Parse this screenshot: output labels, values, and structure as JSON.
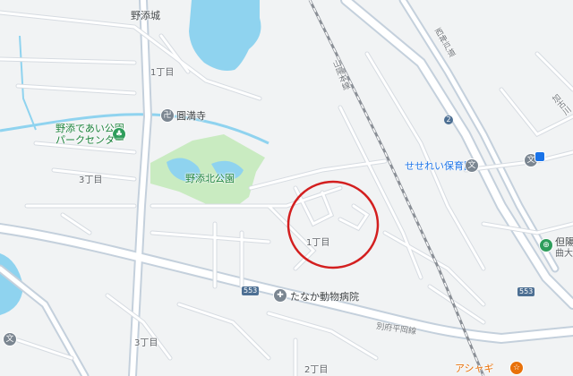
{
  "colors": {
    "background": "#f1f3f4",
    "road": "#ffffff",
    "road_outline": "#c9ced6",
    "major_road": "#c4d0dc",
    "water": "#8fd3ef",
    "park": "#c9ebc1",
    "rail": "#8a8f96",
    "highlight_circle": "#d31f1f"
  },
  "labels": {
    "nozoe_castle": "野添城",
    "enmanji": "圓満寺",
    "nozoe_deai_park_1": "野添であい公園",
    "nozoe_deai_park_2": "パークセンター",
    "nozoe_north_park": "野添北公園",
    "seseragi_nursery": "せせれい保育園",
    "tanaka_vet": "たなか動物病院",
    "block_1_top": "1丁目",
    "block_3_left": "3丁目",
    "block_1_center": "1丁目",
    "block_3_bottom": "3丁目",
    "block_2_bottom": "2丁目",
    "rail_sanyo": "山陽本線",
    "road_saishin": "西神戸道",
    "road_beppu": "別府平岡線",
    "kakogawa_partial": "加古川",
    "tanyo_partial": "但陽",
    "tanyo_sub": "曲大",
    "orange_shop_partial": "アシャギ"
  },
  "shields": {
    "route_553_left": "553",
    "route_553_right": "553",
    "route_2": "2"
  },
  "poi_icons": {
    "temple": "temple-icon",
    "park": "park-icon",
    "nursery": "school-icon",
    "vet": "vet-icon",
    "shop": "shop-icon"
  }
}
